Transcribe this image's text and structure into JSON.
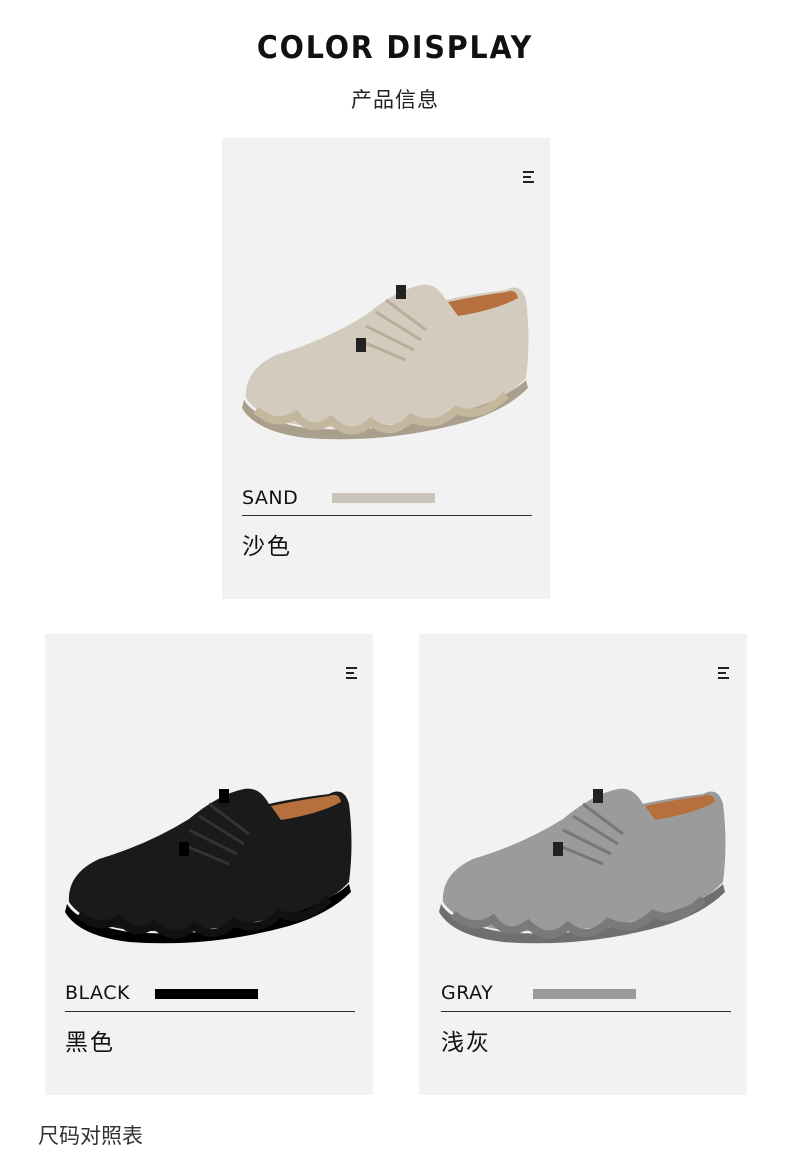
{
  "header": {
    "title": "COLOR DISPLAY",
    "subtitle": "产品信息"
  },
  "cards": [
    {
      "name_en": "SAND",
      "name_cn": "沙色",
      "swatch_color": "#cbc4b8",
      "shoe_color": "#d3cbbd",
      "shoe_dark": "#a99f8c",
      "sole_color": "#c4b79e"
    },
    {
      "name_en": "BLACK",
      "name_cn": "黑色",
      "swatch_color": "#000000",
      "shoe_color": "#1a1a1a",
      "shoe_dark": "#000000",
      "sole_color": "#111111"
    },
    {
      "name_en": "GRAY",
      "name_cn": "浅灰",
      "swatch_color": "#9a9a9a",
      "shoe_color": "#9b9b9b",
      "shoe_dark": "#6f6f6f",
      "sole_color": "#7a7a7a"
    }
  ],
  "icons": {
    "menu": "menu-icon"
  },
  "footer": {
    "cut_text": "尺码对照表"
  }
}
